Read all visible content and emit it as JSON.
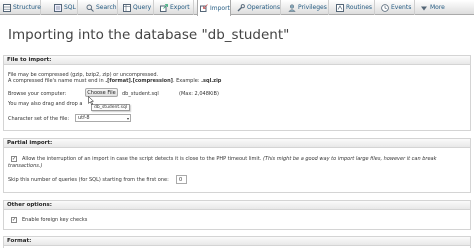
{
  "tabs": [
    {
      "label": "Structure",
      "icon": "structure-icon",
      "active": false
    },
    {
      "label": "SQL",
      "icon": "sql-icon",
      "active": false
    },
    {
      "label": "Search",
      "icon": "search-icon",
      "active": false
    },
    {
      "label": "Query",
      "icon": "query-icon",
      "active": false
    },
    {
      "label": "Export",
      "icon": "export-icon",
      "active": false
    },
    {
      "label": "Import",
      "icon": "import-icon",
      "active": true
    },
    {
      "label": "Operations",
      "icon": "wrench-icon",
      "active": false
    },
    {
      "label": "Privileges",
      "icon": "privileges-icon",
      "active": false
    },
    {
      "label": "Routines",
      "icon": "routines-icon",
      "active": false
    },
    {
      "label": "Events",
      "icon": "clock-icon",
      "active": false
    },
    {
      "label": "More",
      "icon": "chevron-down-icon",
      "active": false
    }
  ],
  "page_title": "Importing into the database \"db_student\"",
  "file_section": {
    "header": "File to import:",
    "compress_line1": "File may be compressed (gzip, bzip2, zip) or uncompressed.",
    "compress_line2_prefix": "A compressed file's name must end in ",
    "compress_line2_bold": ".[format].[compression]",
    "compress_line2_mid": ". Example: ",
    "compress_line2_example": ".sql.zip",
    "browse_label": "Browse your computer:",
    "choose_file_button": "Choose File",
    "chosen_file": "db_student.sql",
    "max_size": "(Max: 2,048KiB)",
    "tooltip": "db_student.sql",
    "drag_drop_text": "You may also drag and drop a",
    "charset_label": "Character set of the file:",
    "charset_value": "utf-8"
  },
  "partial_section": {
    "header": "Partial import:",
    "allow_interrupt_text": "Allow the interruption of an import in case the script detects it is close to the PHP timeout limit.",
    "allow_interrupt_note": "(This might be a good way to import large files, however it can break",
    "allow_interrupt_note2": "transactions.)",
    "allow_interrupt_checked": true,
    "skip_label": "Skip this number of queries (for SQL) starting from the first one:",
    "skip_value": "0"
  },
  "other_section": {
    "header": "Other options:",
    "foreign_keys_text": "Enable foreign key checks",
    "foreign_keys_checked": true
  },
  "format_section": {
    "header": "Format:"
  },
  "colors": {
    "tab_text": "#235a81",
    "header_bg": "#e8e8e8"
  }
}
